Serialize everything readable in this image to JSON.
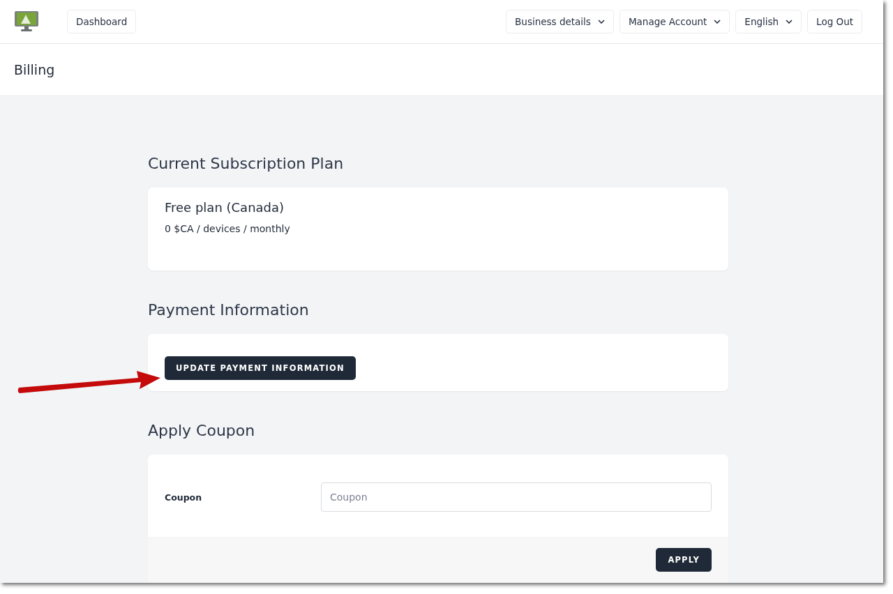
{
  "nav": {
    "left": [
      {
        "label": "Dashboard",
        "kind": "link"
      }
    ],
    "right": [
      {
        "label": "Business details",
        "kind": "dropdown"
      },
      {
        "label": "Manage Account",
        "kind": "dropdown"
      },
      {
        "label": "English",
        "kind": "dropdown"
      },
      {
        "label": "Log Out",
        "kind": "link"
      }
    ]
  },
  "page_title": "Billing",
  "sections": [
    {
      "heading": "Current Subscription Plan",
      "kind": "plan",
      "plan_name": "Free plan (Canada)",
      "price": "0 $CA / devices / monthly"
    },
    {
      "heading": "Payment Information",
      "kind": "action",
      "button": "UPDATE PAYMENT INFORMATION"
    },
    {
      "heading": "Apply Coupon",
      "kind": "form",
      "field_label": "Coupon",
      "placeholder": "Coupon",
      "button": "APPLY"
    }
  ]
}
